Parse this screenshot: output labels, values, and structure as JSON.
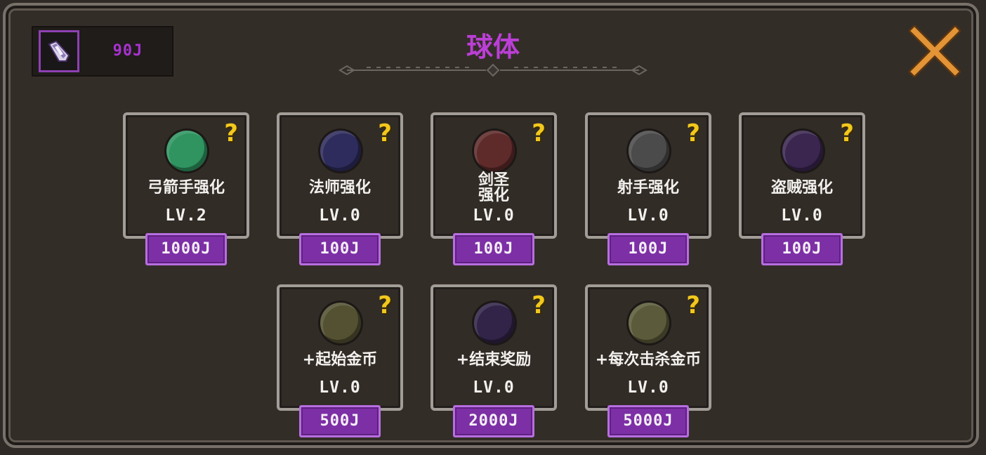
{
  "header": {
    "currency_value": "90J",
    "title": "球体",
    "currency_icon": "crystal-gem-icon",
    "close_icon": "close-x-icon"
  },
  "colors": {
    "accent": "#bb3fd6",
    "price_bg": "#7d2fa5",
    "help_icon": "#f2c81d",
    "close_icon": "#e29436"
  },
  "upgrades": [
    {
      "name": "弓箭手强化",
      "level": "LV.2",
      "price": "1000J",
      "orb_color": "#2f9460"
    },
    {
      "name": "法师强化",
      "level": "LV.0",
      "price": "100J",
      "orb_color": "#2e2c5c"
    },
    {
      "name": "剑圣\n强化",
      "level": "LV.0",
      "price": "100J",
      "orb_color": "#5e2a2a"
    },
    {
      "name": "射手强化",
      "level": "LV.0",
      "price": "100J",
      "orb_color": "#4c4b4b"
    },
    {
      "name": "盗贼强化",
      "level": "LV.0",
      "price": "100J",
      "orb_color": "#3b2650"
    },
    {
      "name": "+起始金币",
      "level": "LV.0",
      "price": "500J",
      "orb_color": "#545132"
    },
    {
      "name": "+结束奖励",
      "level": "LV.0",
      "price": "2000J",
      "orb_color": "#322448"
    },
    {
      "name": "+每次击杀金币",
      "level": "LV.0",
      "price": "5000J",
      "orb_color": "#5b5a3a"
    }
  ],
  "help_label": "?"
}
